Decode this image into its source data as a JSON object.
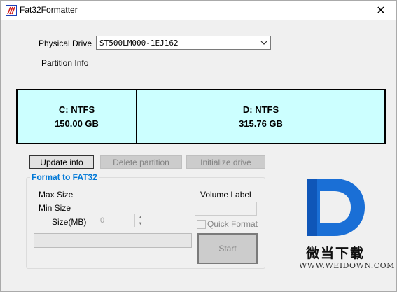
{
  "window": {
    "title": "Fat32Formatter",
    "close_glyph": "✕"
  },
  "drive": {
    "label": "Physical Drive",
    "selected": "ST500LM000-1EJ162",
    "dropdown_icon": "chevron-down-icon"
  },
  "partition_info_label": "Partition Info",
  "partitions": [
    {
      "name": "C: NTFS",
      "size": "150.00 GB"
    },
    {
      "name": "D: NTFS",
      "size": "315.76 GB"
    }
  ],
  "partition_fill_color": "#ccffff",
  "buttons": {
    "update": "Update info",
    "delete": "Delete partition",
    "initialize": "Initialize drive",
    "start": "Start"
  },
  "format": {
    "group_title": "Format to FAT32",
    "max_size_label": "Max Size",
    "min_size_label": "Min Size",
    "size_label": "Size(MB)",
    "size_value": "0",
    "volume_label": "Volume Label",
    "volume_value": "",
    "quick_format_label": "Quick Format",
    "quick_format_checked": false,
    "progress": 0
  },
  "watermark": {
    "text_cn": "微当下载",
    "url": "WWW.WEIDOWN.COM",
    "color": "#1a6fd6"
  }
}
